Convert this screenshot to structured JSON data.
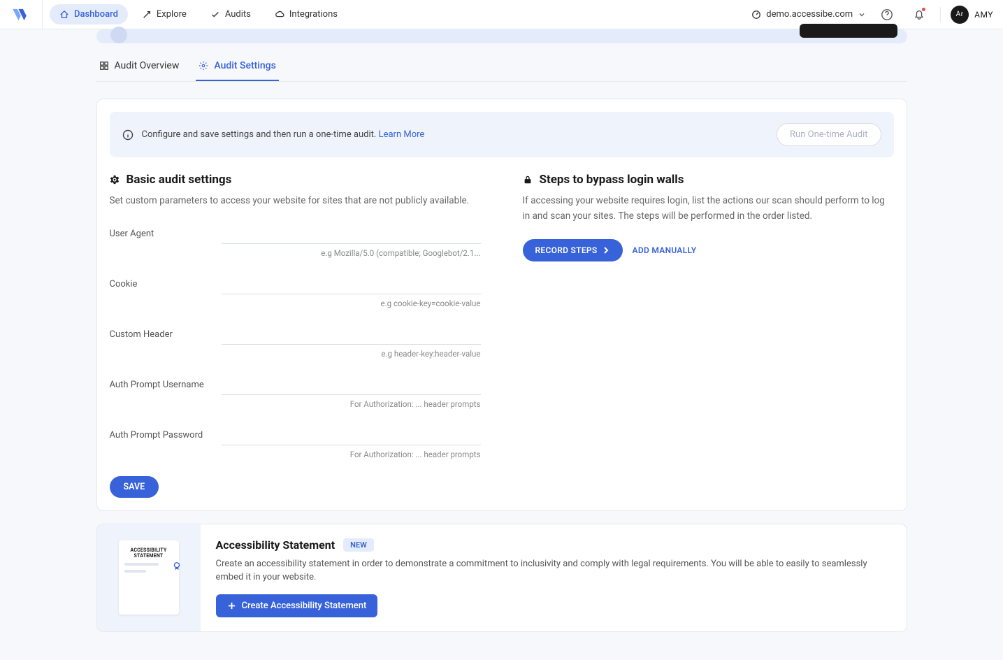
{
  "nav": {
    "dashboard": "Dashboard",
    "explore": "Explore",
    "audits": "Audits",
    "integrations": "Integrations"
  },
  "header": {
    "domain": "demo.accessibe.com",
    "avatar_initials": "Ar",
    "user_name": "AMY"
  },
  "tabs": {
    "overview": "Audit Overview",
    "settings": "Audit Settings"
  },
  "info_bar": {
    "text": "Configure and save settings and then run a one-time audit.",
    "learn_more": "Learn More",
    "run_button": "Run One-time Audit"
  },
  "basic": {
    "title": "Basic audit settings",
    "desc": "Set custom parameters to access your website for sites that are not publicly available.",
    "fields": [
      {
        "label": "User Agent",
        "hint": "e.g Mozilla/5.0 (compatible; Googlebot/2.1...",
        "value": ""
      },
      {
        "label": "Cookie",
        "hint": "e.g cookie-key=cookie-value",
        "value": ""
      },
      {
        "label": "Custom Header",
        "hint": "e.g header-key:header-value",
        "value": ""
      },
      {
        "label": "Auth Prompt Username",
        "hint": "For Authorization: ... header prompts",
        "value": ""
      },
      {
        "label": "Auth Prompt Password",
        "hint": "For Authorization: ... header prompts",
        "value": ""
      }
    ],
    "save": "SAVE"
  },
  "bypass": {
    "title": "Steps to bypass login walls",
    "desc": "If accessing your website requires login, list the actions our scan should perform to log in and scan your sites. The steps will be performed in the order listed.",
    "record": "RECORD STEPS",
    "add_manually": "ADD MANUALLY"
  },
  "statement": {
    "title": "Accessibility Statement",
    "badge": "NEW",
    "preview_line1": "ACCESSIBILITY",
    "preview_line2": "STATEMENT",
    "desc": "Create an accessibility statement in order to demonstrate a commitment to inclusivity and comply with legal requirements. You will be able to easily to seamlessly embed it in your website.",
    "create": "Create Accessibility Statement"
  }
}
